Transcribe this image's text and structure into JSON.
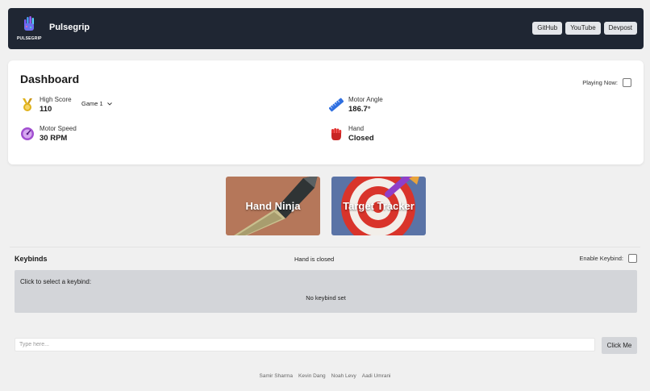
{
  "navbar": {
    "logo_text": "PULSEGRIP",
    "brand": "Pulsegrip",
    "links": [
      "GitHub",
      "YouTube",
      "Devpost"
    ]
  },
  "dashboard": {
    "title": "Dashboard",
    "playing_now_label": "Playing Now:",
    "playing_now_checked": false,
    "stats": {
      "high_score": {
        "label": "High Score",
        "value": "110",
        "icon": "medal-icon",
        "color": "#e0b21b"
      },
      "motor_speed": {
        "label": "Motor Speed",
        "value": "30 RPM",
        "icon": "speedometer-icon",
        "color": "#a24fd1"
      },
      "motor_angle": {
        "label": "Motor Angle",
        "value": "186.7°",
        "icon": "ruler-icon",
        "color": "#2f6fe0"
      },
      "hand": {
        "label": "Hand",
        "value": "Closed",
        "icon": "fist-icon",
        "color": "#e2312f"
      }
    },
    "game_select": {
      "selected": "Game 1"
    }
  },
  "games": [
    {
      "label": "Hand Ninja",
      "icon": "knife-icon",
      "bg": "#b5775a"
    },
    {
      "label": "Target Tracker",
      "icon": "target-icon",
      "bg": "#5a73a6"
    }
  ],
  "keybinds": {
    "title": "Keybinds",
    "status": "Hand is closed",
    "enable_label": "Enable Keybind:",
    "enable_checked": false,
    "prompt": "Click to select a keybind:",
    "current": "No keybind set"
  },
  "input": {
    "placeholder": "Type here...",
    "value": "",
    "button_label": "Click Me"
  },
  "footer": {
    "names": [
      "Samir Sharma",
      "Kevin Dang",
      "Noah Levy",
      "Aadi Umrani"
    ]
  }
}
